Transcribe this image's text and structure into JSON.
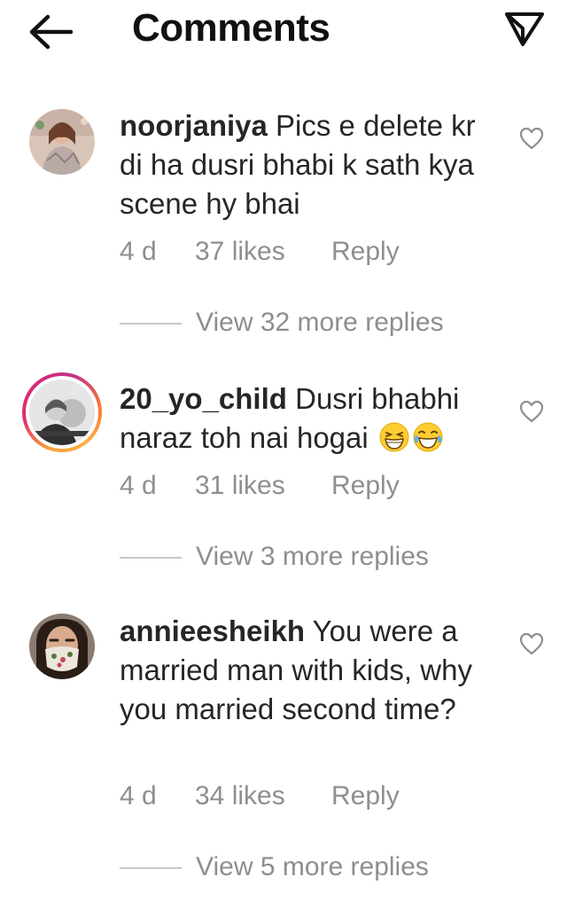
{
  "header": {
    "title": "Comments",
    "back_icon": "arrow-left-icon",
    "share_icon": "paper-plane-icon"
  },
  "comments": [
    {
      "username": "noorjaniya",
      "text": " Pics e delete kr di ha dusri bhabi k sath kya scene hy bhai",
      "time": "4 d",
      "likes": "37 likes",
      "reply": "Reply",
      "view_replies": "View 32 more replies",
      "has_story_ring": false
    },
    {
      "username": "20_yo_child",
      "text": " Dusri bhabhi naraz toh nai hogai ",
      "emojis": [
        "grinning-squinting-face-emoji",
        "face-with-tears-of-joy-emoji"
      ],
      "time": "4 d",
      "likes": "31 likes",
      "reply": "Reply",
      "view_replies": "View 3 more replies",
      "has_story_ring": true
    },
    {
      "username": "annieesheikh",
      "text": " You were a married man with kids, why you married second time?",
      "time": "4 d",
      "likes": "34 likes",
      "reply": "Reply",
      "view_replies": "View 5 more replies",
      "has_story_ring": false
    }
  ],
  "colors": {
    "text": "#262626",
    "secondary": "#8e8e8e",
    "divider": "#c7c7c7",
    "ring_start": "#f9a23b",
    "ring_end": "#c13584"
  }
}
